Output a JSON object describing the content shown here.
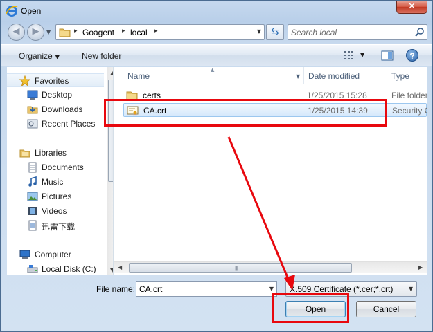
{
  "window": {
    "title": "Open",
    "close_glyph": "✕"
  },
  "address": {
    "path": [
      "Goagent",
      "local"
    ],
    "separator": "▸",
    "search_placeholder": "Search local"
  },
  "toolbar": {
    "organize_label": "Organize",
    "new_folder_label": "New folder",
    "help_label": "?"
  },
  "nav": {
    "items": [
      {
        "label": "Favorites",
        "icon": "star-icon"
      },
      {
        "label": "Desktop",
        "icon": "desktop-icon"
      },
      {
        "label": "Downloads",
        "icon": "downloads-icon"
      },
      {
        "label": "Recent Places",
        "icon": "recent-places-icon"
      },
      {
        "label": "Libraries",
        "icon": "libraries-icon"
      },
      {
        "label": "Documents",
        "icon": "documents-icon"
      },
      {
        "label": "Music",
        "icon": "music-icon"
      },
      {
        "label": "Pictures",
        "icon": "pictures-icon"
      },
      {
        "label": "Videos",
        "icon": "videos-icon"
      },
      {
        "label": "迅雷下载",
        "icon": "folder-icon"
      },
      {
        "label": "Computer",
        "icon": "computer-icon"
      },
      {
        "label": "Local Disk (C:)",
        "icon": "local-disk-icon"
      }
    ]
  },
  "file_list": {
    "columns": [
      "Name",
      "Date modified",
      "Type"
    ],
    "rows": [
      {
        "name": "certs",
        "date": "1/25/2015 15:28",
        "type": "File folder",
        "icon": "folder-icon"
      },
      {
        "name": "CA.crt",
        "date": "1/25/2015 14:39",
        "type": "Security C",
        "icon": "certificate-icon"
      }
    ]
  },
  "bottom": {
    "file_name_label": "File name:",
    "file_name_value": "CA.crt",
    "file_type_value": "X.509 Certificate (*.cer;*.crt)",
    "open_label": "Open",
    "cancel_label": "Cancel"
  },
  "colors": {
    "annotation_red": "#e8080e",
    "selection_blue": "#d5e8fb"
  }
}
